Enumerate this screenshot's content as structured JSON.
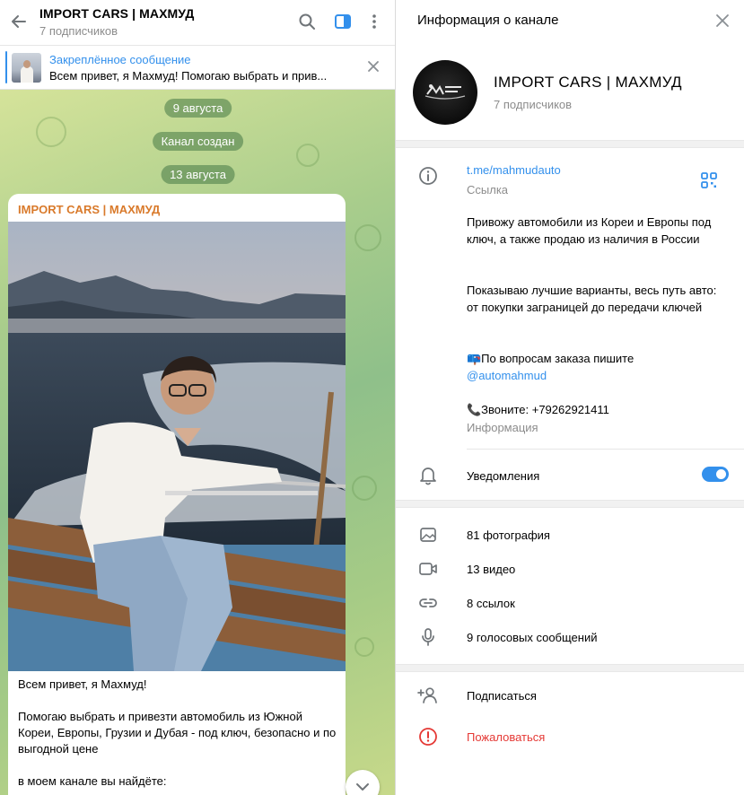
{
  "chat": {
    "title": "IMPORT CARS | МАХМУД",
    "subtitle": "7 подписчиков",
    "pinned": {
      "title": "Закреплённое сообщение",
      "text": "Всем привет, я Махмуд!  Помогаю выбрать и прив..."
    },
    "dates": [
      "9 августа",
      "Канал создан",
      "13 августа"
    ],
    "message": {
      "author": "IMPORT CARS | МАХМУД",
      "text": "Всем привет, я Махмуд!\n\nПомогаю выбрать и привезти автомобиль из Южной Кореи, Европы, Грузии и Дубая - под ключ, безопасно и по выгодной цене\n\nв моем канале вы найдёте:"
    }
  },
  "info": {
    "title": "Информация о канале",
    "channel_name": "IMPORT CARS | МАХМУД",
    "subscribers": "7 подписчиков",
    "link": "t.me/mahmudauto",
    "link_caption": "Ссылка",
    "description": {
      "p1": "Привожу автомобили из Кореи и Европы под ключ, а также продаю из наличия в России",
      "p2": "Показываю лучшие варианты, весь путь авто: от покупки заграницей до передачи ключей",
      "p3_prefix": "📪По вопросам заказа пишите",
      "p3_link": "@automahmud",
      "p4": "📞Звоните: +79262921411",
      "caption": "Информация"
    },
    "notifications_label": "Уведомления",
    "notifications_on": true,
    "media": {
      "photos": "81 фотография",
      "videos": "13 видео",
      "links": "8 ссылок",
      "voice": "9 голосовых сообщений"
    },
    "actions": {
      "subscribe": "Подписаться",
      "report": "Пожаловаться"
    }
  },
  "colors": {
    "accent": "#3390ec",
    "author": "#d97a2b",
    "danger": "#e53935",
    "muted": "#8c8c8c"
  }
}
